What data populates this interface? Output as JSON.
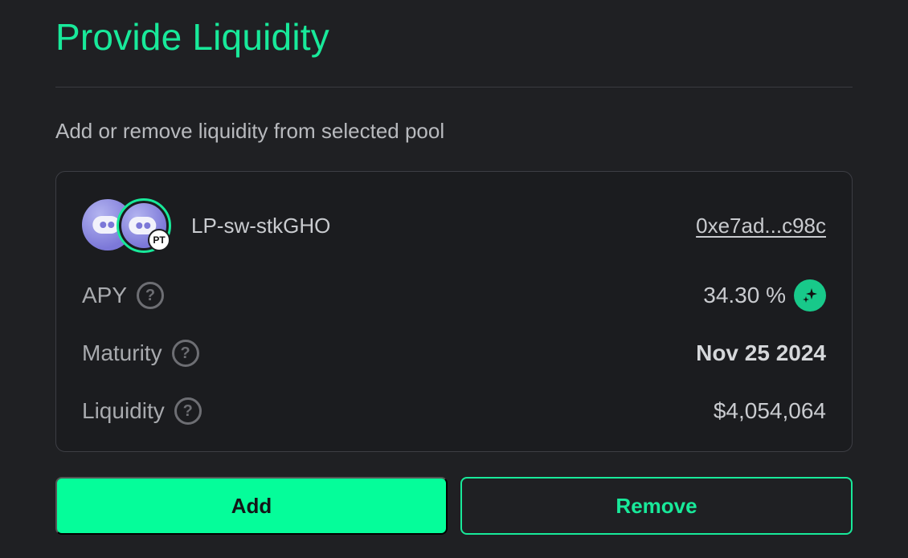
{
  "header": {
    "title": "Provide Liquidity",
    "subtitle": "Add or remove liquidity from selected pool"
  },
  "pool": {
    "name": "LP-sw-stkGHO",
    "address": "0xe7ad...c98c",
    "badge": "PT",
    "rows": [
      {
        "label": "APY",
        "value": "34.30 %",
        "icon": "sparkle-icon"
      },
      {
        "label": "Maturity",
        "value": "Nov 25 2024"
      },
      {
        "label": "Liquidity",
        "value": "$4,054,064"
      }
    ]
  },
  "actions": {
    "add_label": "Add",
    "remove_label": "Remove"
  },
  "colors": {
    "accent": "#05fd9a",
    "background": "#1f2023",
    "card": "#1b1c1f"
  }
}
